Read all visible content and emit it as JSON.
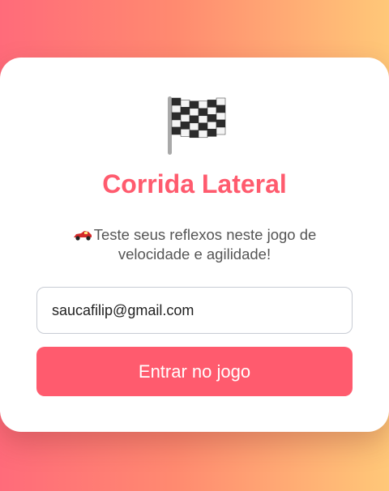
{
  "login": {
    "icon": "checkered-flag-icon",
    "title": "Corrida Lateral",
    "subtitle_icon": "race-car-icon",
    "subtitle": "Teste seus reflexos neste jogo de velocidade e agilidade!",
    "email_value": "saucafilip@gmail.com",
    "button_label": "Entrar no jogo"
  },
  "colors": {
    "accent": "#ff5b6e",
    "background_start": "#ff6b7a",
    "background_end": "#ffc878",
    "card": "#ffffff"
  }
}
